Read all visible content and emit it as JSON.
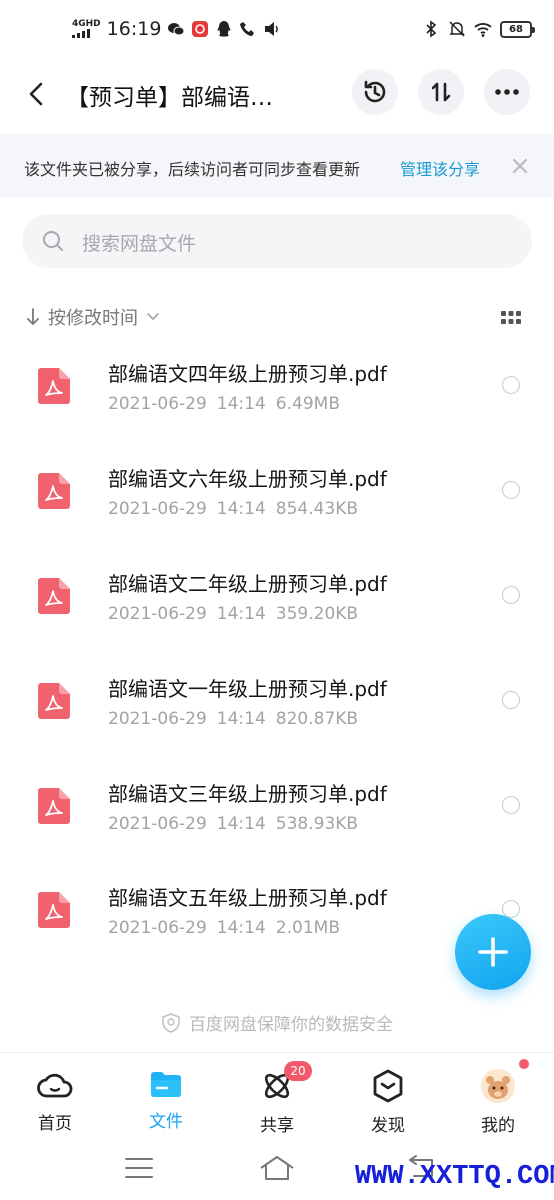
{
  "status_bar": {
    "network": "4GHD",
    "time": "16:19",
    "battery": "68"
  },
  "header": {
    "title": "【预习单】部编语…",
    "back_icon": "chevron-left-icon",
    "history_icon": "history-icon",
    "sort_icon": "swap-vertical-icon",
    "more_icon": "more-horizontal-icon"
  },
  "share_bar": {
    "text": "该文件夹已被分享，后续访问者可同步查看更新",
    "link": "管理该分享"
  },
  "search": {
    "placeholder": "搜索网盘文件"
  },
  "sort": {
    "label": "按修改时间"
  },
  "files": [
    {
      "name": "部编语文四年级上册预习单.pdf",
      "date": "2021-06-29",
      "time": "14:14",
      "size": "6.49MB"
    },
    {
      "name": "部编语文六年级上册预习单.pdf",
      "date": "2021-06-29",
      "time": "14:14",
      "size": "854.43KB"
    },
    {
      "name": "部编语文二年级上册预习单.pdf",
      "date": "2021-06-29",
      "time": "14:14",
      "size": "359.20KB"
    },
    {
      "name": "部编语文一年级上册预习单.pdf",
      "date": "2021-06-29",
      "time": "14:14",
      "size": "820.87KB"
    },
    {
      "name": "部编语文三年级上册预习单.pdf",
      "date": "2021-06-29",
      "time": "14:14",
      "size": "538.93KB"
    },
    {
      "name": "部编语文五年级上册预习单.pdf",
      "date": "2021-06-29",
      "time": "14:14",
      "size": "2.01MB"
    }
  ],
  "footer_note": "百度网盘保障你的数据安全",
  "tabs": [
    {
      "label": "首页",
      "icon": "cloud-icon"
    },
    {
      "label": "文件",
      "icon": "folder-icon",
      "active": true
    },
    {
      "label": "共享",
      "icon": "atom-icon",
      "badge": "20"
    },
    {
      "label": "发现",
      "icon": "discover-box-icon"
    },
    {
      "label": "我的",
      "icon": "avatar-icon"
    }
  ],
  "watermark": "WWW.XXTTQ.COM",
  "colors": {
    "accent": "#14a4ef",
    "pdf_red": "#f0626e",
    "badge": "#f25a6b"
  }
}
